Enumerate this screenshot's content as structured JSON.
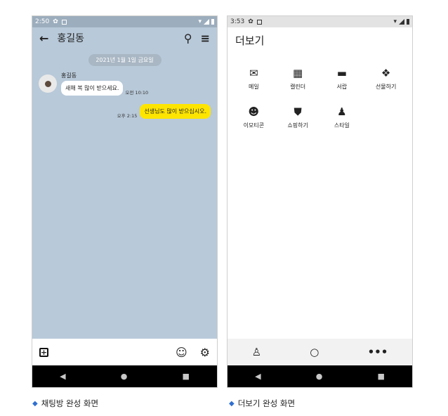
{
  "chat_screen": {
    "status": {
      "time": "2:50"
    },
    "header": {
      "back_icon": "←",
      "title": "홍길동",
      "search_icon": "⚲",
      "menu_icon": "≡"
    },
    "date_divider": "2021년 1월 1일 금요일",
    "received": {
      "sender": "홍길동",
      "text": "새해 복 많이 받으세요.",
      "time": "오전 10:10"
    },
    "sent": {
      "text": "선생님도 많이 받으십시오.",
      "time": "오후 2:15"
    },
    "input_bar": {
      "add_icon": "+",
      "emoji_icon": "☺",
      "settings_icon": "⚙"
    },
    "nav": {
      "back": "◀",
      "home": "●",
      "recent": "■"
    }
  },
  "more_screen": {
    "status": {
      "time": "3:53"
    },
    "title": "더보기",
    "items": [
      {
        "icon": "✉",
        "label": "메일"
      },
      {
        "icon": "▦",
        "label": "캘린더"
      },
      {
        "icon": "▬",
        "label": "서랍"
      },
      {
        "icon": "❖",
        "label": "선물하기"
      },
      {
        "icon": "☻",
        "label": "이모티콘"
      },
      {
        "icon": "⛊",
        "label": "쇼핑하기"
      },
      {
        "icon": "♟",
        "label": "스타일"
      }
    ],
    "tabs": {
      "friends_icon": "♙",
      "chats_icon": "○",
      "more_icon": "•••"
    },
    "nav": {
      "back": "◀",
      "home": "●",
      "recent": "■"
    }
  },
  "captions": {
    "left": "채팅방 완성 화면",
    "right": "더보기 완성 화면",
    "bullet": "◆"
  },
  "colors": {
    "chat_bg": "#b8c9d9",
    "sent_bubble": "#fee500",
    "caption_bullet": "#2f6fd0"
  }
}
